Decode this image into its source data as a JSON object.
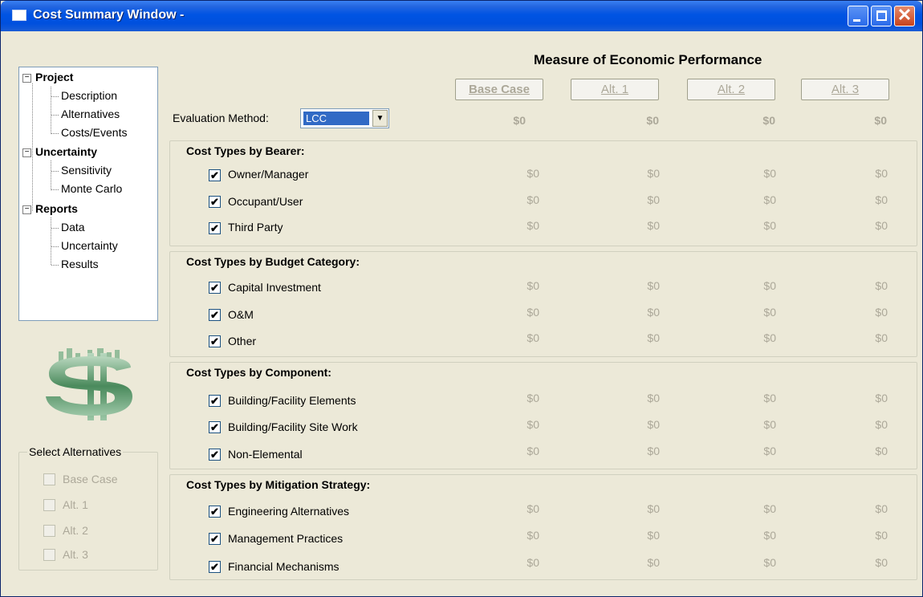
{
  "window": {
    "title": "Cost Summary Window -"
  },
  "tree": {
    "project": {
      "label": "Project",
      "children": [
        "Description",
        "Alternatives",
        "Costs/Events"
      ]
    },
    "uncertainty": {
      "label": "Uncertainty",
      "children": [
        "Sensitivity",
        "Monte Carlo"
      ]
    },
    "reports": {
      "label": "Reports",
      "children": [
        "Data",
        "Uncertainty",
        "Results"
      ]
    }
  },
  "select_alternatives": {
    "title": "Select Alternatives",
    "items": [
      "Base Case",
      "Alt. 1",
      "Alt. 2",
      "Alt. 3"
    ]
  },
  "header": {
    "performance_title": "Measure of Economic Performance",
    "columns": [
      "Base Case",
      "Alt. 1",
      "Alt. 2",
      "Alt. 3"
    ],
    "eval_label": "Evaluation Method:",
    "eval_value": "LCC",
    "totals": [
      "$0",
      "$0",
      "$0",
      "$0"
    ]
  },
  "groups": [
    {
      "title": "Cost Types by Bearer:",
      "rows": [
        {
          "label": "Owner/Manager",
          "checked": true,
          "values": [
            "$0",
            "$0",
            "$0",
            "$0"
          ]
        },
        {
          "label": "Occupant/User",
          "checked": true,
          "values": [
            "$0",
            "$0",
            "$0",
            "$0"
          ]
        },
        {
          "label": "Third Party",
          "checked": true,
          "values": [
            "$0",
            "$0",
            "$0",
            "$0"
          ]
        }
      ]
    },
    {
      "title": "Cost Types by Budget Category:",
      "rows": [
        {
          "label": "Capital Investment",
          "checked": true,
          "values": [
            "$0",
            "$0",
            "$0",
            "$0"
          ]
        },
        {
          "label": "O&M",
          "checked": true,
          "values": [
            "$0",
            "$0",
            "$0",
            "$0"
          ]
        },
        {
          "label": "Other",
          "checked": true,
          "values": [
            "$0",
            "$0",
            "$0",
            "$0"
          ]
        }
      ]
    },
    {
      "title": "Cost Types by Component:",
      "rows": [
        {
          "label": "Building/Facility Elements",
          "checked": true,
          "values": [
            "$0",
            "$0",
            "$0",
            "$0"
          ]
        },
        {
          "label": "Building/Facility Site Work",
          "checked": true,
          "values": [
            "$0",
            "$0",
            "$0",
            "$0"
          ]
        },
        {
          "label": "Non-Elemental",
          "checked": true,
          "values": [
            "$0",
            "$0",
            "$0",
            "$0"
          ]
        }
      ]
    },
    {
      "title": "Cost Types by Mitigation Strategy:",
      "rows": [
        {
          "label": "Engineering Alternatives",
          "checked": true,
          "values": [
            "$0",
            "$0",
            "$0",
            "$0"
          ]
        },
        {
          "label": "Management Practices",
          "checked": true,
          "values": [
            "$0",
            "$0",
            "$0",
            "$0"
          ]
        },
        {
          "label": "Financial Mechanisms",
          "checked": true,
          "values": [
            "$0",
            "$0",
            "$0",
            "$0"
          ]
        }
      ]
    }
  ],
  "colors": {
    "titlebar": "#0054e3",
    "disabled_text": "#aca899",
    "selection": "#316ac5",
    "logo_green": "#4a8a5c"
  },
  "icons": [
    "window-icon",
    "minimize-icon",
    "maximize-icon",
    "close-icon",
    "tree-collapse-icon",
    "dollar-logo-icon",
    "dropdown-arrow-icon",
    "checkmark-icon"
  ]
}
